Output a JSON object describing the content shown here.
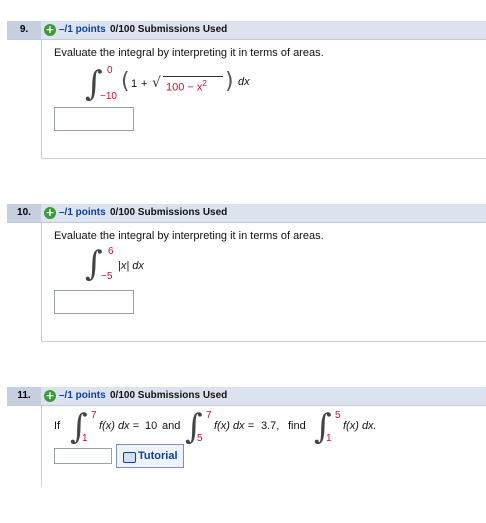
{
  "questions": [
    {
      "number": "9.",
      "points": "–/1 points",
      "submissions": "0/100 Submissions Used",
      "prompt": "Evaluate the integral by interpreting it in terms of areas.",
      "upper": "0",
      "lower": "−10",
      "integrand_one": "1",
      "plus": "+",
      "radicand": "100 − x",
      "exponent": "2",
      "dx": "dx"
    },
    {
      "number": "10.",
      "points": "–/1 points",
      "submissions": "0/100 Submissions Used",
      "prompt": "Evaluate the integral by interpreting it in terms of areas.",
      "upper": "6",
      "lower": "−5",
      "integrand": "|x| dx"
    },
    {
      "number": "11.",
      "points": "–/1 points",
      "submissions": "0/100 Submissions Used",
      "if": "If",
      "int1_upper": "7",
      "int1_lower": "1",
      "int1_body": "f(x) dx =",
      "int1_value": "10",
      "and": "and",
      "int2_upper": "7",
      "int2_lower": "5",
      "int2_body": "f(x) dx =",
      "int2_value": "3.7,",
      "find": "find",
      "int3_upper": "5",
      "int3_lower": "1",
      "int3_body": "f(x) dx.",
      "tutorial_label": "Tutorial"
    }
  ],
  "colors": {
    "header_bg": "#dde3ee",
    "points_blue": "#0b3fa8",
    "limit_red": "#c8102e",
    "plus_green": "#3a9b3a"
  }
}
